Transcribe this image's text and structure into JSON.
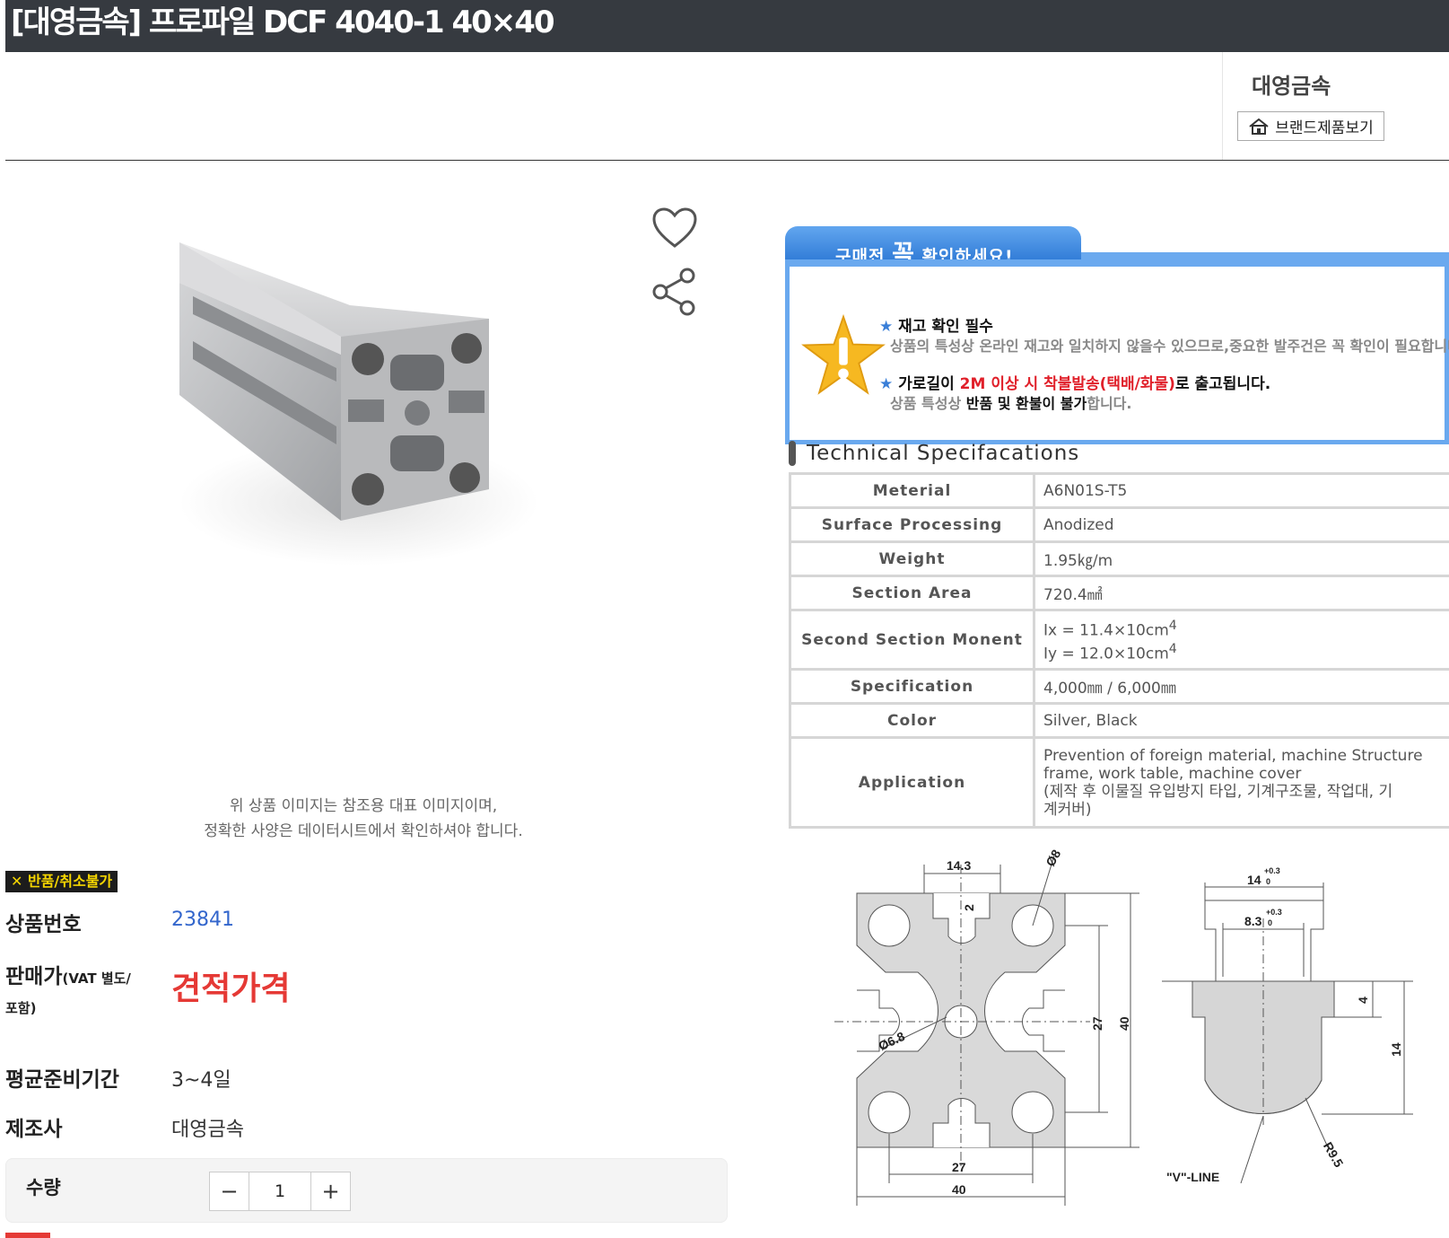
{
  "product": {
    "title": "[대영금속] 프로파일 DCF 4040-1 40×40",
    "image_note_line1": "위 상품 이미지는 참조용 대표 이미지이며,",
    "image_note_line2": "정확한 사양은 데이터시트에서 확인하셔야 합니다."
  },
  "brand": {
    "name": "대영금속",
    "button_label": "브랜드제품보기"
  },
  "badge": {
    "no_return": "✕ 반품/취소불가"
  },
  "info": {
    "code_label": "상품번호",
    "code_value": "23841",
    "price_label": "판매가",
    "price_label_small": "(VAT 별도/",
    "price_label_line2": "포함)",
    "price_value": "견적가격",
    "lead_label": "평균준비기간",
    "lead_value": "3~4일",
    "maker_label": "제조사",
    "maker_value": "대영금속"
  },
  "quantity": {
    "label": "수량",
    "value": "1",
    "minus": "−",
    "plus": "+"
  },
  "notice": {
    "tab_pre": "구매전",
    "tab_emph": "꼭",
    "tab_post": "확인하세요!",
    "line1": "재고 확인 필수",
    "line2": "상품의 특성상 온라인 재고와 일치하지 않을수 있으므로,중요한 발주건은 꼭 확인이 필요합니다",
    "line3_pre": "가로길이",
    "line3_red": "2M 이상 시 착불발송(택배/화물)",
    "line3_post": "로 출고됩니다.",
    "line4_pre": "상품 특성상",
    "line4_dark": "반품 및 환불이 불가",
    "line4_post": "합니다.",
    "bullet": "★"
  },
  "spec": {
    "title": "Technical Specifacations",
    "rows": [
      {
        "key": "Meterial",
        "value": "A6N01S-T5"
      },
      {
        "key": "Surface Processing",
        "value": "Anodized"
      },
      {
        "key": "Weight",
        "value": "1.95㎏/m"
      },
      {
        "key": "Section Area",
        "value": "720.4㎟"
      },
      {
        "key": "Second Section Monent",
        "value1": "Ix = 11.4×10cm",
        "value2": "Iy = 12.0×10cm",
        "sup": "4"
      },
      {
        "key": "Specification",
        "value": "4,000㎜ / 6,000㎜"
      },
      {
        "key": "Color",
        "value": "Silver, Black"
      },
      {
        "key": "Application",
        "value1": "Prevention of foreign material, machine Structure",
        "value2": "frame, work table, machine cover",
        "value3": "(제작 후 이물질 유입방지 타입, 기계구조물, 작업대, 기",
        "value4": "계커버)"
      }
    ]
  },
  "drawing": {
    "dim_14_3": "14.3",
    "dim_2": "2",
    "dim_08": "Ø8",
    "dim_068": "Ø6.8",
    "dim_27v": "27",
    "dim_40v": "40",
    "dim_27h": "27",
    "dim_40h": "40",
    "dim_14": "14",
    "dim_14_tol": "+0.3",
    "dim_14_tol0": "0",
    "dim_8_3": "8.3",
    "dim_4": "4",
    "dim_14b": "14",
    "dim_r95": "R9.5",
    "vline": "\"V\"-LINE"
  },
  "colors": {
    "title_bg": "#363a40",
    "accent_blue": "#6aa9ef",
    "price_red": "#e53935",
    "code_blue": "#3366cc"
  }
}
